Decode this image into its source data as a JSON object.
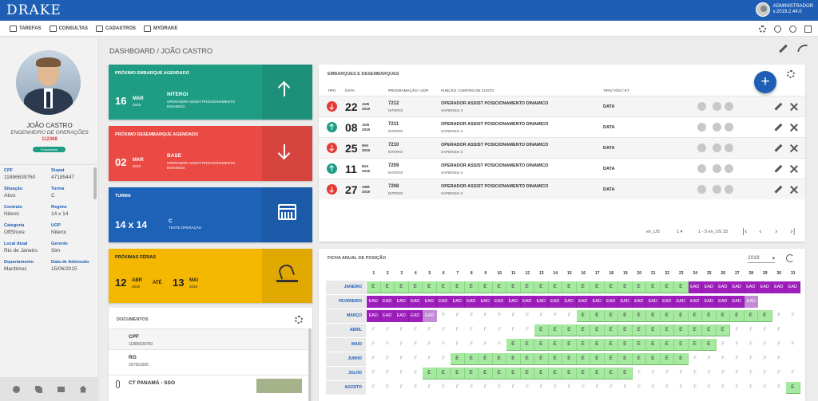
{
  "app": {
    "logo": "DRAKE",
    "user_name": "ADMINISTRADOR",
    "version": "v.2019.2.44.0"
  },
  "menu": {
    "items": [
      "TAREFAS",
      "CONSULTAS",
      "CADASTROS",
      "MYDRAKE"
    ]
  },
  "profile": {
    "name": "JOÃO CASTRO",
    "role": "ENGENHEIRO DE OPERAÇÕES",
    "id": "112368",
    "badge": "Funcionário",
    "fields": [
      {
        "label": "CPF",
        "value": "11886639760"
      },
      {
        "label": "Sispat",
        "value": "47185447"
      },
      {
        "label": "Situação",
        "value": "Ativo"
      },
      {
        "label": "Turma",
        "value": "C"
      },
      {
        "label": "Contrato",
        "value": "Niteroi"
      },
      {
        "label": "Regime",
        "value": "14 x 14"
      },
      {
        "label": "Categoria",
        "value": "OffShore"
      },
      {
        "label": "UOP",
        "value": "Niteroi"
      },
      {
        "label": "Local Atual",
        "value": "Rio de Janeiro"
      },
      {
        "label": "Gerente",
        "value": "Sim"
      },
      {
        "label": "Departamento",
        "value": "Marítimos"
      },
      {
        "label": "Data de Admissão",
        "value": "15/06/2015"
      }
    ]
  },
  "breadcrumb": "DASHBOARD / JOÃO CASTRO",
  "cards": {
    "embarque": {
      "title": "PRÓXIMO EMBARQUE AGENDADO",
      "day": "16",
      "month": "MAR",
      "year": "2019",
      "place": "NITEROI",
      "desc": "OPERADOR ASSIST POSICIONAMENTO DINAMICO"
    },
    "desembarque": {
      "title": "PRÓXIMO DESEMBARQUE AGENDADO",
      "day": "02",
      "month": "MAR",
      "year": "2019",
      "place": "BASE",
      "desc": "OPERADOR ASSIST POSICIONAMENTO DINAMICO"
    },
    "turma": {
      "title": "TURMA",
      "regime": "14 x 14",
      "code": "C",
      "desc": "TESTE OPERAÇÃO"
    },
    "ferias": {
      "title": "PRÓXIMAS FÉRIAS",
      "start_day": "12",
      "start_month": "ABR",
      "start_year": "2019",
      "sep": "ATÉ",
      "end_day": "13",
      "end_month": "MAI",
      "end_year": "2019"
    }
  },
  "colors": {
    "embarque": "#1f9d84",
    "desembarque": "#ea4a43",
    "turma": "#1e62b8",
    "ferias": "#f5b800"
  },
  "documents": {
    "title": "DOCUMENTOS",
    "items": [
      {
        "name": "CPF",
        "value": "11886639760"
      },
      {
        "name": "RG",
        "value": "207953365"
      },
      {
        "name": "CT PANAMÁ - SSO",
        "value": ""
      }
    ]
  },
  "embarques": {
    "title": "EMBARQUES E DESEMBARQUES",
    "add_label": "+",
    "columns": [
      "TIPO",
      "DATA",
      "PROGRAMAÇÃO / UOP",
      "FUNÇÃO / CENTRO DE CUSTO",
      "TIPO/ VÔO / KT"
    ],
    "rows": [
      {
        "dir": "down",
        "day": "22",
        "month": "JUN",
        "year": "2019",
        "prog": "7212",
        "uop": "NITEROI",
        "func": "OPERADOR ASSIST POSICIONAMENTO DINAMICO",
        "cc": "SAPIENSIA 3",
        "tipo": "DATA"
      },
      {
        "dir": "up",
        "day": "08",
        "month": "JUN",
        "year": "2019",
        "prog": "7211",
        "uop": "NITEROI",
        "func": "OPERADOR ASSIST POSICIONAMENTO DINAMICO",
        "cc": "SAPIENSIA 3",
        "tipo": "DATA"
      },
      {
        "dir": "down",
        "day": "25",
        "month": "MAI",
        "year": "2019",
        "prog": "7210",
        "uop": "NITEROI",
        "func": "OPERADOR ASSIST POSICIONAMENTO DINAMICO",
        "cc": "SAPIENSIA 3",
        "tipo": "DATA"
      },
      {
        "dir": "up",
        "day": "11",
        "month": "MAI",
        "year": "2019",
        "prog": "7209",
        "uop": "NITEROI",
        "func": "OPERADOR ASSIST POSICIONAMENTO DINAMICO",
        "cc": "SAPIENSIA 3",
        "tipo": "DATA"
      },
      {
        "dir": "down",
        "day": "27",
        "month": "ABR",
        "year": "2019",
        "prog": "7208",
        "uop": "NITEROI",
        "func": "OPERADOR ASSIST POSICIONAMENTO DINAMICO",
        "cc": "SAPIENSIA 3",
        "tipo": "DATA"
      }
    ],
    "locale": "en_US",
    "per_page": "1",
    "range": "1 - 5 en_US 33"
  },
  "ficha": {
    "title": "FICHA ANUAL DE POSIÇÃO",
    "year": "2019",
    "months": [
      "JANEIRO",
      "FEVEREIRO",
      "MARÇO",
      "ABRIL",
      "MAIO",
      "JUNHO",
      "JULHO",
      "AGOSTO"
    ],
    "days": 31,
    "rows": [
      "E,E,E,E,E,E,E,E,E,E,E,E,E,E,E,E,E,E,E,E,E,E,E,EAD,EAD,EAD,EAD,EAD,EAD,EAD,EAD",
      "EAD,EAD,EAD,EAD,EAD,EAD,EAD,EAD,EAD,EAD,EAD,EAD,EAD,EAD,EAD,EAD,EAD,EAD,EAD,EAD,EAD,EAD,EAD,EAD,EAD,EAD,EAD,EADl,,,",
      "EAD,EAD,EAD,EAD,EADl,F,F,F,F,F,F,F,F,F,F,E,E,E,E,E,E,E,E,E,E,E,E,E,E,F,F",
      "F,F,F,F,F,F,F,F,F,F,F,F,E,E,E,E,E,E,E,E,E,E,E,E,E,E,F,F,F,F,",
      "F,F,F,F,F,F,F,F,F,F,E,E,E,E,E,E,E,E,E,E,E,E,E,E,E,F,F,F,F,F,F",
      "F,F,F,F,F,F,E,E,E,E,E,E,E,E,E,E,E,E,E,E,E,E,E,F,F,F,F,F,F,F,",
      "F,F,F,F,E,E,E,E,E,E,E,E,E,E,E,E,E,E,E,F,F,F,F,F,F,F,F,F,F,F,F",
      "F,F,F,F,F,F,F,F,F,F,F,F,F,F,F,F,F,F,F,F,F,F,F,F,F,F,F,F,F,F,E"
    ]
  }
}
